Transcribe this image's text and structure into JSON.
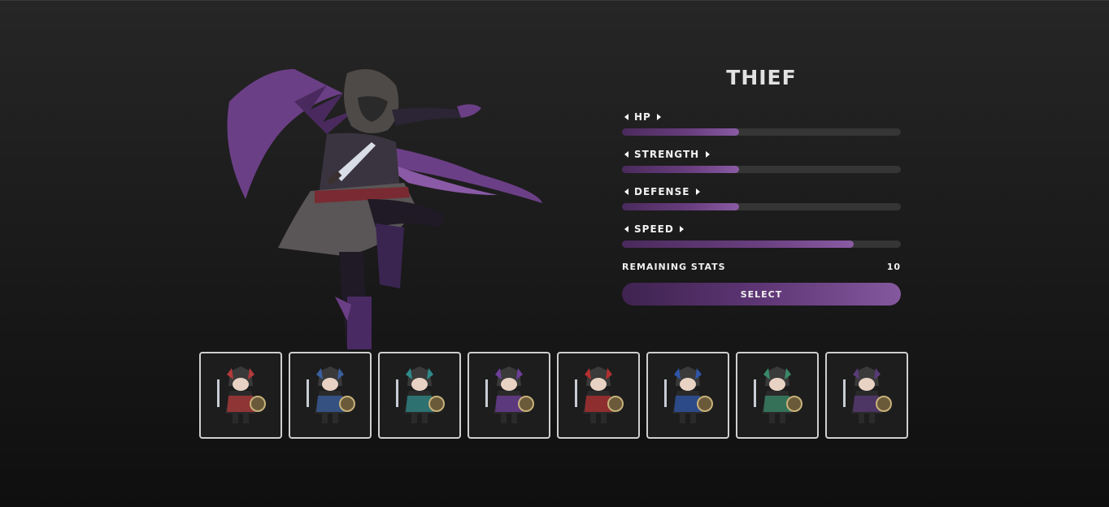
{
  "character": {
    "class_name": "THIEF",
    "portrait_icon": "hooded-thief-portrait",
    "accent_color": "#6a3f80"
  },
  "stats": [
    {
      "label": "HP",
      "fill": 0.42
    },
    {
      "label": "STRENGTH",
      "fill": 0.42
    },
    {
      "label": "DEFENSE",
      "fill": 0.42
    },
    {
      "label": "SPEED",
      "fill": 0.83
    }
  ],
  "remaining": {
    "label": "REMAINING STATS",
    "value": "10"
  },
  "select_button": {
    "label": "SELECT"
  },
  "roster": [
    {
      "name": "warrior-sword-icon",
      "accent": "#b23a3a"
    },
    {
      "name": "spear-knight-icon",
      "accent": "#3a5fa0"
    },
    {
      "name": "axe-fighter-icon",
      "accent": "#2f8a8a"
    },
    {
      "name": "archer-icon",
      "accent": "#6d3e9a"
    },
    {
      "name": "red-mage-icon",
      "accent": "#b23030"
    },
    {
      "name": "blue-mage-icon",
      "accent": "#2f56a8"
    },
    {
      "name": "armored-axe-knight-icon",
      "accent": "#3a8a6a"
    },
    {
      "name": "thief-icon",
      "accent": "#5a3a78"
    }
  ]
}
